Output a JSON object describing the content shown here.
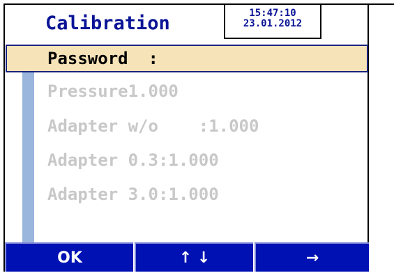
{
  "header": {
    "title": "Calibration",
    "time": "15:47:10",
    "date": "23.01.2012"
  },
  "selected": {
    "label": "Password  :"
  },
  "list": [
    "Pressure1.000",
    "Adapter w/o    :1.000",
    "Adapter 0.3:1.000",
    "Adapter 3.0:1.000"
  ],
  "softkeys": {
    "ok": "OK",
    "updown": "↑ ↓",
    "next": "→"
  },
  "colors": {
    "title_text": "#0a1496",
    "selected_bg": "#f6e3b8",
    "softkey_bg": "#0011b4",
    "disabled_text": "#c8c8c8",
    "side_strip": "#9ab6dd"
  }
}
